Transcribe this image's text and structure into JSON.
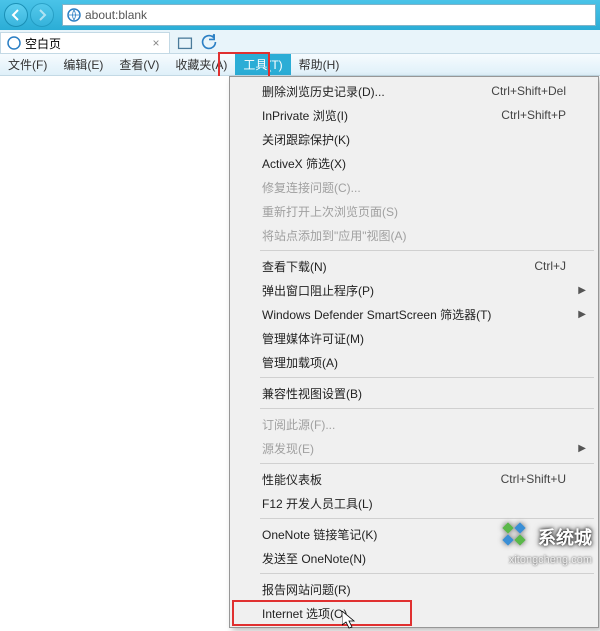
{
  "address_bar": {
    "url": "about:blank"
  },
  "tab": {
    "title": "空白页"
  },
  "menu": {
    "items": [
      {
        "label": "文件(F)"
      },
      {
        "label": "编辑(E)"
      },
      {
        "label": "查看(V)"
      },
      {
        "label": "收藏夹(A)"
      },
      {
        "label": "工具(T)"
      },
      {
        "label": "帮助(H)"
      }
    ],
    "active_index": 4
  },
  "tools_menu": {
    "groups": [
      [
        {
          "label": "删除浏览历史记录(D)...",
          "shortcut": "Ctrl+Shift+Del",
          "disabled": false
        },
        {
          "label": "InPrivate 浏览(I)",
          "shortcut": "Ctrl+Shift+P",
          "disabled": false
        },
        {
          "label": "关闭跟踪保护(K)",
          "shortcut": "",
          "disabled": false
        },
        {
          "label": "ActiveX 筛选(X)",
          "shortcut": "",
          "disabled": false
        },
        {
          "label": "修复连接问题(C)...",
          "shortcut": "",
          "disabled": true
        },
        {
          "label": "重新打开上次浏览页面(S)",
          "shortcut": "",
          "disabled": true
        },
        {
          "label": "将站点添加到\"应用\"视图(A)",
          "shortcut": "",
          "disabled": true
        }
      ],
      [
        {
          "label": "查看下载(N)",
          "shortcut": "Ctrl+J",
          "disabled": false
        },
        {
          "label": "弹出窗口阻止程序(P)",
          "shortcut": "",
          "disabled": false,
          "submenu": true
        },
        {
          "label": "Windows Defender SmartScreen 筛选器(T)",
          "shortcut": "",
          "disabled": false,
          "submenu": true
        },
        {
          "label": "管理媒体许可证(M)",
          "shortcut": "",
          "disabled": false
        },
        {
          "label": "管理加载项(A)",
          "shortcut": "",
          "disabled": false
        }
      ],
      [
        {
          "label": "兼容性视图设置(B)",
          "shortcut": "",
          "disabled": false
        }
      ],
      [
        {
          "label": "订阅此源(F)...",
          "shortcut": "",
          "disabled": true
        },
        {
          "label": "源发现(E)",
          "shortcut": "",
          "disabled": true,
          "submenu": true
        }
      ],
      [
        {
          "label": "性能仪表板",
          "shortcut": "Ctrl+Shift+U",
          "disabled": false
        },
        {
          "label": "F12 开发人员工具(L)",
          "shortcut": "",
          "disabled": false
        }
      ],
      [
        {
          "label": "OneNote 链接笔记(K)",
          "shortcut": "",
          "disabled": false
        },
        {
          "label": "发送至 OneNote(N)",
          "shortcut": "",
          "disabled": false
        }
      ],
      [
        {
          "label": "报告网站问题(R)",
          "shortcut": "",
          "disabled": false
        },
        {
          "label": "Internet 选项(O)",
          "shortcut": "",
          "disabled": false
        }
      ]
    ]
  },
  "watermark": {
    "brand": "系统城",
    "url": "xitongcheng.com"
  }
}
